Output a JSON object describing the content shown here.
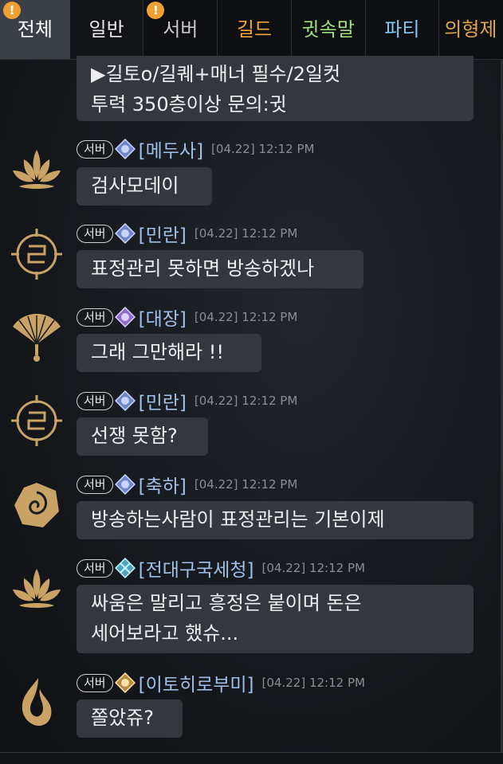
{
  "tabs": [
    {
      "label": "전체",
      "color": "#ffffff",
      "badge": "!"
    },
    {
      "label": "일반",
      "color": "#e9e9ea",
      "badge": ""
    },
    {
      "label": "서버",
      "color": "#c9c9cb",
      "badge": "!"
    },
    {
      "label": "길드",
      "color": "#f2a33a",
      "badge": ""
    },
    {
      "label": "귓속말",
      "color": "#9be07a",
      "badge": ""
    },
    {
      "label": "파티",
      "color": "#86c8ee",
      "badge": ""
    },
    {
      "label": "의형제",
      "color": "#e0a64c",
      "badge": ""
    }
  ],
  "server_tag": "서버",
  "top_message": {
    "lines": [
      "▶길토o/길퀘+매너 필수/2일컷",
      "투력 350층이상 문의:귓"
    ]
  },
  "messages": [
    {
      "name": "[메두사]",
      "time": "[04.22] 12:12 PM",
      "lines": [
        "검사모데이"
      ],
      "avatar": "lotus-icon",
      "rank": "rank-emblem-blue-icon"
    },
    {
      "name": "[민란]",
      "time": "[04.22] 12:12 PM",
      "lines": [
        "표정관리 못하면 방송하겠나"
      ],
      "avatar": "knot-emblem-icon",
      "rank": "rank-emblem-blue-icon"
    },
    {
      "name": "[대장]",
      "time": "[04.22] 12:12 PM",
      "lines": [
        "그래 그만해라 !!"
      ],
      "avatar": "fan-icon",
      "rank": "rank-emblem-purple-icon"
    },
    {
      "name": "[민란]",
      "time": "[04.22] 12:12 PM",
      "lines": [
        "선쟁 못함?"
      ],
      "avatar": "knot-emblem-icon",
      "rank": "rank-emblem-blue-icon"
    },
    {
      "name": "[축하]",
      "time": "[04.22] 12:12 PM",
      "lines": [
        "방송하는사람이 표정관리는 기본이제"
      ],
      "avatar": "rose-icon",
      "rank": "rank-emblem-blue-icon"
    },
    {
      "name": "[전대구국세청]",
      "time": "[04.22] 12:12 PM",
      "lines": [
        "싸움은 말리고 흥정은 붙이며 돈은",
        "세어보라고 했슈..."
      ],
      "avatar": "lotus-icon",
      "rank": "rank-emblem-cyan-icon"
    },
    {
      "name": "[이토히로부미]",
      "time": "[04.22] 12:12 PM",
      "lines": [
        "쫄았쥬?"
      ],
      "avatar": "flame-icon",
      "rank": "rank-emblem-gold-icon"
    }
  ]
}
